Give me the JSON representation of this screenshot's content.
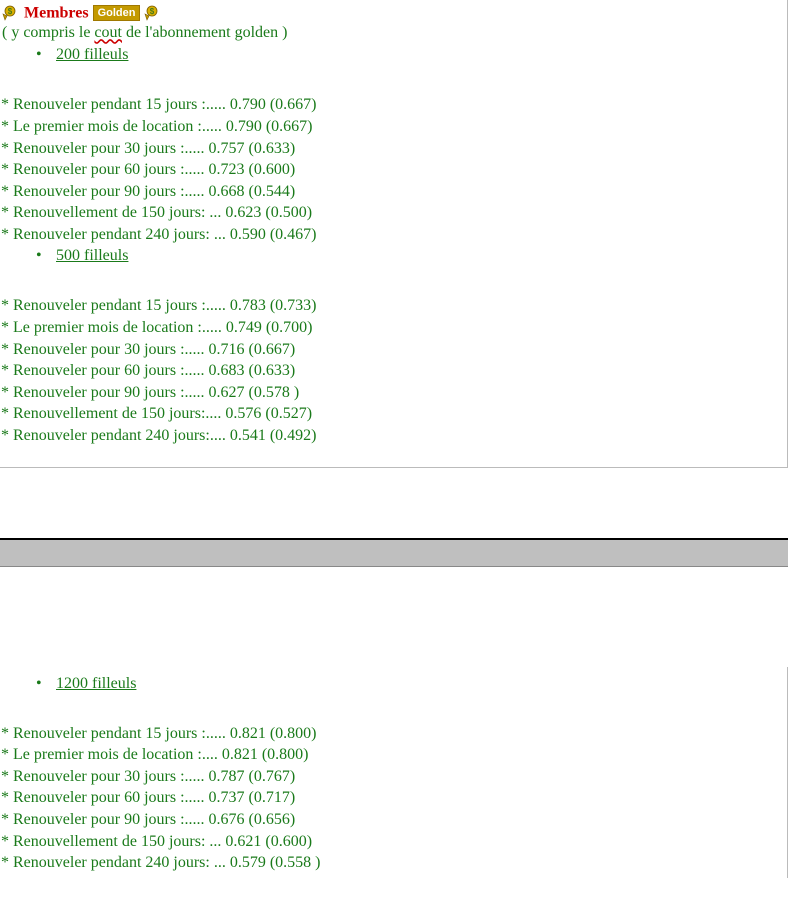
{
  "header": {
    "title": "Membres",
    "badge": "Golden",
    "subtitle_prefix": "( y compris le ",
    "subtitle_wavy": "cout",
    "subtitle_suffix": " de l'abonnement golden )"
  },
  "sections": [
    {
      "link_label": "200 filleuls",
      "rows": [
        "* Renouveler pendant 15 jours :..... 0.790 (0.667)",
        "* Le premier mois de location :..... 0.790 (0.667)",
        "* Renouveler pour 30 jours :..... 0.757 (0.633)",
        "* Renouveler pour 60 jours :..... 0.723 (0.600)",
        "* Renouveler pour 90 jours :..... 0.668 (0.544)",
        "* Renouvellement de 150 jours: ... 0.623 (0.500)",
        "* Renouveler pendant 240 jours: ... 0.590 (0.467)"
      ]
    },
    {
      "link_label": "500 filleuls",
      "rows": [
        "* Renouveler pendant 15 jours :..... 0.783 (0.733)",
        "* Le premier mois de location :..... 0.749 (0.700)",
        "* Renouveler pour 30 jours :..... 0.716 (0.667)",
        "* Renouveler pour 60 jours :..... 0.683 (0.633)",
        "* Renouveler pour 90 jours :..... 0.627 (0.578 )",
        "* Renouvellement de 150 jours:.... 0.576 (0.527)",
        "* Renouveler pendant 240 jours:.... 0.541 (0.492)"
      ]
    },
    {
      "link_label": "1200 filleuls",
      "rows": [
        "* Renouveler pendant 15 jours :..... 0.821 (0.800)",
        "* Le premier mois de location :.... 0.821 (0.800)",
        "* Renouveler pour 30 jours :..... 0.787 (0.767)",
        "* Renouveler pour 60 jours :..... 0.737 (0.717)",
        "* Renouveler pour 90 jours :..... 0.676 (0.656)",
        "* Renouvellement de 150 jours: ... 0.621 (0.600)",
        "* Renouveler pendant 240 jours: ... 0.579 (0.558 )"
      ]
    }
  ]
}
